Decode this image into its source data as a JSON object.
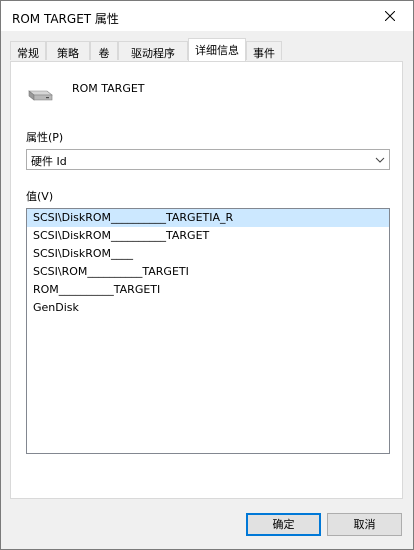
{
  "window": {
    "title": "ROM TARGET 属性"
  },
  "tabs": [
    {
      "label": "常规"
    },
    {
      "label": "策略"
    },
    {
      "label": "卷"
    },
    {
      "label": "驱动程序"
    },
    {
      "label": "详细信息",
      "active": true
    },
    {
      "label": "事件"
    }
  ],
  "device": {
    "name": "ROM TARGET",
    "icon": "drive-icon"
  },
  "property": {
    "label": "属性(P)",
    "selected": "硬件 Id"
  },
  "value": {
    "label": "值(V)",
    "items": [
      "SCSI\\DiskROM__________TARGETIA_R",
      "SCSI\\DiskROM__________TARGET",
      "SCSI\\DiskROM____",
      "SCSI\\ROM__________TARGETI",
      "ROM__________TARGETI",
      "GenDisk"
    ]
  },
  "buttons": {
    "ok": "确定",
    "cancel": "取消"
  },
  "colors": {
    "selection": "#cce8ff",
    "default_button_border": "#0078d7"
  }
}
